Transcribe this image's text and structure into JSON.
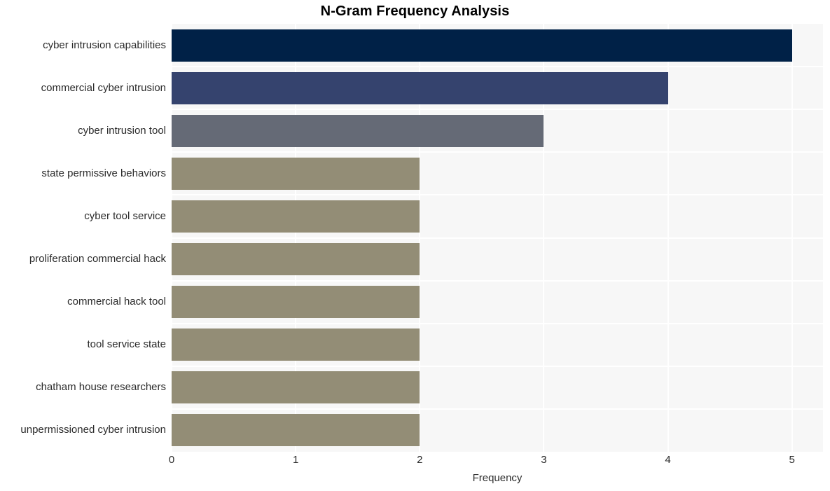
{
  "chart_data": {
    "type": "bar",
    "orientation": "horizontal",
    "title": "N-Gram Frequency Analysis",
    "xlabel": "Frequency",
    "ylabel": "",
    "xlim": [
      0,
      5.25
    ],
    "xticks": [
      "0",
      "1",
      "2",
      "3",
      "4",
      "5"
    ],
    "xtick_values": [
      0,
      1,
      2,
      3,
      4,
      5
    ],
    "grid": true,
    "grid_axis": "both",
    "legend": "none",
    "plot_background": "#f7f7f7",
    "grid_color": "#ffffff",
    "categories": [
      "cyber intrusion capabilities",
      "commercial cyber intrusion",
      "cyber intrusion tool",
      "state permissive behaviors",
      "cyber tool service",
      "proliferation commercial hack",
      "commercial hack tool",
      "tool service state",
      "chatham house researchers",
      "unpermissioned cyber intrusion"
    ],
    "values": [
      5,
      4,
      3,
      2,
      2,
      2,
      2,
      2,
      2,
      2
    ],
    "bar_colors": [
      "#002147",
      "#35436e",
      "#656a76",
      "#938d76",
      "#938d76",
      "#938d76",
      "#938d76",
      "#938d76",
      "#938d76",
      "#938d76"
    ]
  }
}
